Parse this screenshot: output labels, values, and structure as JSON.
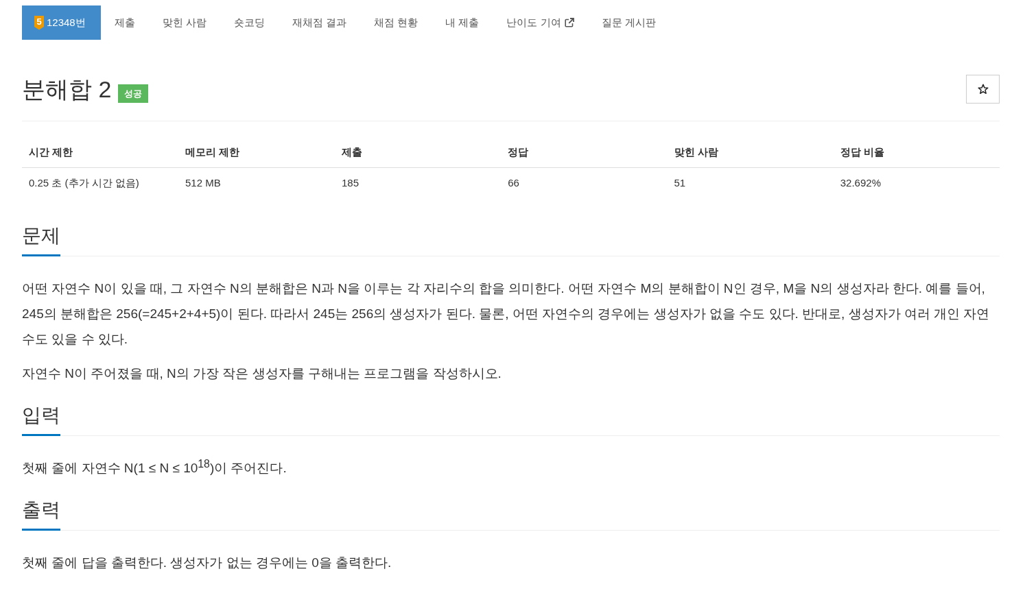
{
  "nav_tabs": [
    {
      "kind": "problem",
      "tier": "5",
      "label": "12348번",
      "selected": true
    },
    {
      "kind": "link",
      "label": "제출",
      "selected": false
    },
    {
      "kind": "link",
      "label": "맞힌 사람",
      "selected": false
    },
    {
      "kind": "link",
      "label": "숏코딩",
      "selected": false
    },
    {
      "kind": "link",
      "label": "재채점 결과",
      "selected": false
    },
    {
      "kind": "link",
      "label": "채점 현황",
      "selected": false
    },
    {
      "kind": "link",
      "label": "내 제출",
      "selected": false
    },
    {
      "kind": "external",
      "label": "난이도 기여",
      "selected": false
    },
    {
      "kind": "link",
      "label": "질문 게시판",
      "selected": false
    }
  ],
  "problem": {
    "title": "분해합 2",
    "result_label": "성공",
    "starred": false
  },
  "info_table": {
    "columns": [
      "시간 제한",
      "메모리 제한",
      "제출",
      "정답",
      "맞힌 사람",
      "정답 비율"
    ],
    "rows": [
      [
        "0.25 초 (추가 시간 없음)",
        "512 MB",
        "185",
        "66",
        "51",
        "32.692%"
      ]
    ]
  },
  "sections": [
    {
      "heading": "문제",
      "paragraphs": [
        "어떤 자연수 N이 있을 때, 그 자연수 N의 분해합은 N과 N을 이루는 각 자리수의 합을 의미한다. 어떤 자연수 M의 분해합이 N인 경우, M을 N의 생성자라 한다. 예를 들어, 245의 분해합은 256(=245+2+4+5)이 된다. 따라서 245는 256의 생성자가 된다. 물론, 어떤 자연수의 경우에는 생성자가 없을 수도 있다. 반대로, 생성자가 여러 개인 자연수도 있을 수 있다.",
        "자연수 N이 주어졌을 때, N의 가장 작은 생성자를 구해내는 프로그램을 작성하시오."
      ]
    },
    {
      "heading": "입력",
      "paragraphs": [
        "첫째 줄에 자연수 N(1 ≤ N ≤ 10$^{18}$)이 주어진다."
      ]
    },
    {
      "heading": "출력",
      "paragraphs": [
        "첫째 줄에 답을 출력한다. 생성자가 없는 경우에는 0을 출력한다."
      ]
    }
  ]
}
